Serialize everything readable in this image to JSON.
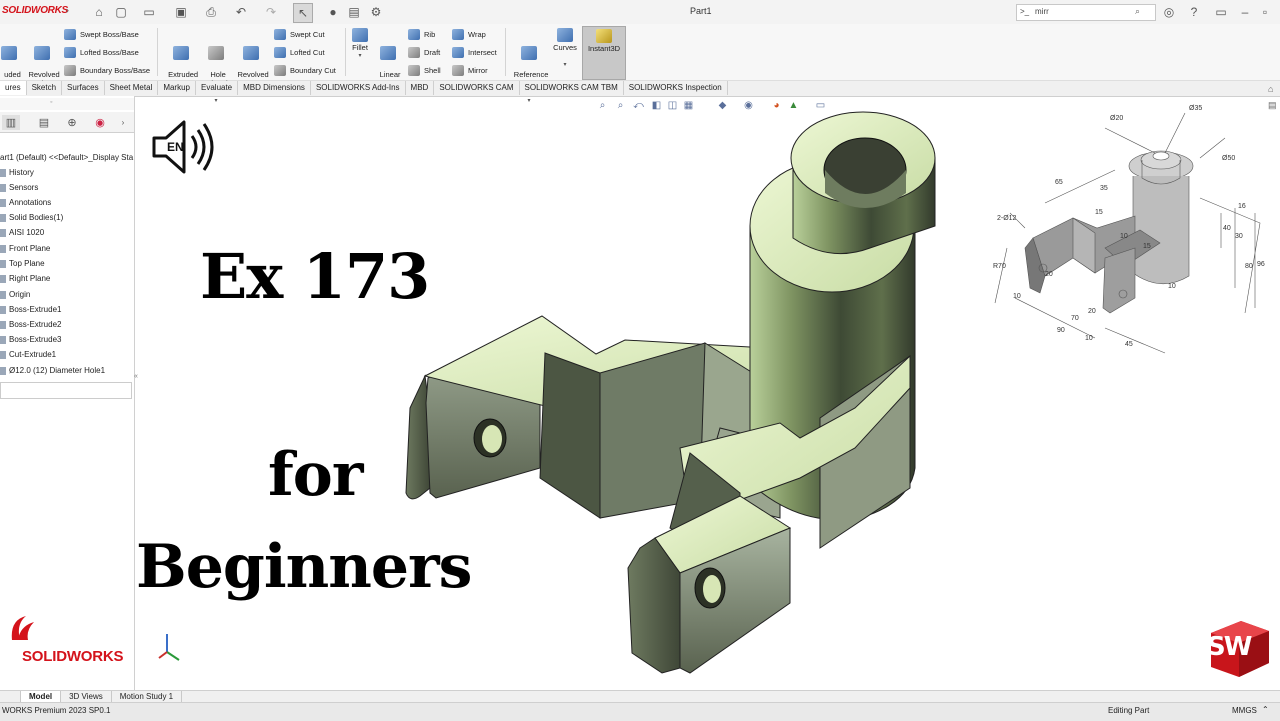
{
  "app": {
    "logo_text": "SOLIDWORKS",
    "doc_title": "Part1"
  },
  "search": {
    "value": "mirr",
    "icon": "terminal-icon"
  },
  "commands": {
    "extruded_boss_partial": "uded\nBase",
    "revolved_boss": "Revolved\nBoss/Base",
    "swept_boss": "Swept Boss/Base",
    "lofted_boss": "Lofted Boss/Base",
    "boundary_boss": "Boundary Boss/Base",
    "extruded_cut": "Extruded\nCut",
    "hole_wizard": "Hole\nWizard",
    "revolved_cut": "Revolved\nCut",
    "swept_cut": "Swept Cut",
    "lofted_cut": "Lofted Cut",
    "boundary_cut": "Boundary Cut",
    "fillet": "Fillet",
    "linear_pattern": "Linear\nPattern",
    "rib": "Rib",
    "draft": "Draft",
    "shell": "Shell",
    "wrap": "Wrap",
    "intersect": "Intersect",
    "mirror": "Mirror",
    "reference_geometry": "Reference\nGeometry",
    "curves": "Curves",
    "instant3d": "Instant3D"
  },
  "tabs": [
    {
      "label": "ures",
      "active": true
    },
    {
      "label": "Sketch"
    },
    {
      "label": "Surfaces"
    },
    {
      "label": "Sheet Metal"
    },
    {
      "label": "Markup"
    },
    {
      "label": "Evaluate"
    },
    {
      "label": "MBD Dimensions"
    },
    {
      "label": "SOLIDWORKS Add-Ins"
    },
    {
      "label": "MBD"
    },
    {
      "label": "SOLIDWORKS CAM"
    },
    {
      "label": "SOLIDWORKS CAM TBM"
    },
    {
      "label": "SOLIDWORKS Inspection"
    }
  ],
  "tree": {
    "root": "art1 (Default) <<Default>_Display Sta",
    "items": [
      "History",
      "Sensors",
      "Annotations",
      "Solid Bodies(1)",
      "AISI 1020",
      "Front Plane",
      "Top Plane",
      "Right Plane",
      "Origin",
      "Boss-Extrude1",
      "Boss-Extrude2",
      "Boss-Extrude3",
      "Cut-Extrude1",
      "Ø12.0 (12) Diameter Hole1"
    ]
  },
  "overlay": {
    "line1": "Ex 173",
    "line2": "for",
    "line3": "Beginners",
    "audio_badge": "EN",
    "brand": "SOLIDWORKS",
    "sw_badge": "SW"
  },
  "drawing_dims": {
    "d1": "Ø20",
    "d2": "Ø35",
    "d3": "Ø50",
    "d4": "65",
    "d5": "35",
    "d6": "15",
    "d7": "2-Ø12",
    "d8": "R70",
    "d9": "20",
    "d10": "10",
    "d11": "70",
    "d12": "90",
    "d13": "10",
    "d14": "20",
    "d15": "45",
    "d16": "10",
    "d17": "15",
    "d18": "16",
    "d19": "40",
    "d20": "30",
    "d21": "96",
    "d22": "80",
    "d23": "10"
  },
  "bottom_tabs": [
    {
      "label": "Model",
      "active": true
    },
    {
      "label": "3D Views"
    },
    {
      "label": "Motion Study 1"
    }
  ],
  "status": {
    "version": "WORKS Premium 2023 SP0.1",
    "mode": "Editing Part",
    "units": "MMGS"
  }
}
